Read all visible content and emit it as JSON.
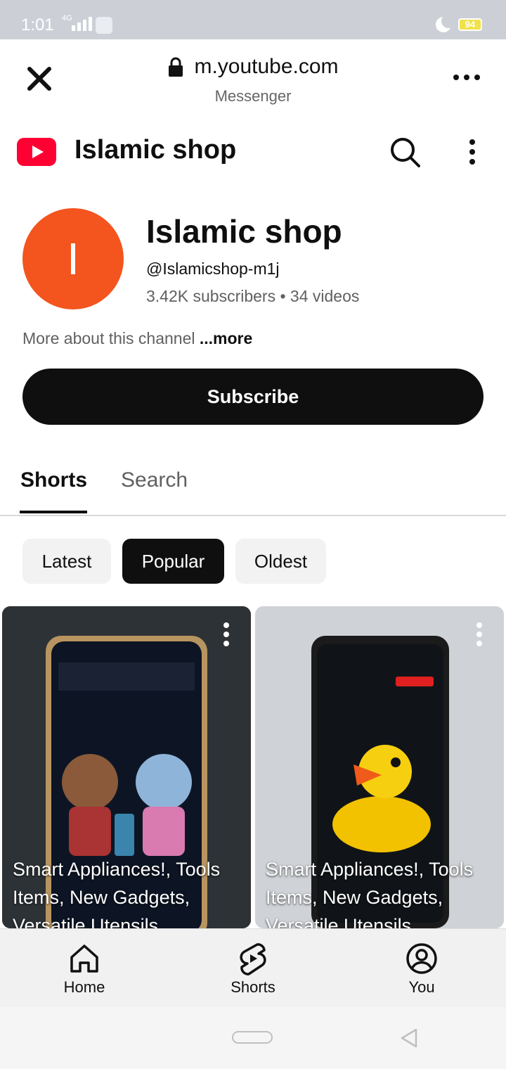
{
  "status_bar": {
    "time": "1:01",
    "network": "4G",
    "battery": "94"
  },
  "browser": {
    "url": "m.youtube.com",
    "subtitle": "Messenger"
  },
  "app_header": {
    "title": "Islamic shop"
  },
  "channel": {
    "avatar_letter": "I",
    "name": "Islamic shop",
    "handle": "@Islamicshop-m1j",
    "stats": "3.42K subscribers • 34 videos",
    "about": "More about this channel ",
    "about_more": "...more",
    "subscribe_label": "Subscribe"
  },
  "tabs": [
    {
      "label": "Shorts",
      "active": true
    },
    {
      "label": "Search",
      "active": false
    }
  ],
  "chips": [
    {
      "label": "Latest",
      "selected": false
    },
    {
      "label": "Popular",
      "selected": true
    },
    {
      "label": "Oldest",
      "selected": false
    }
  ],
  "shorts": [
    {
      "title": "Smart Appliances!, Tools Items, New Gadgets, Versatile Utensils"
    },
    {
      "title": "Smart Appliances!, Tools Items, New Gadgets, Versatile Utensils"
    }
  ],
  "bottom_nav": [
    {
      "label": "Home",
      "icon": "home-icon"
    },
    {
      "label": "Shorts",
      "icon": "shorts-icon"
    },
    {
      "label": "You",
      "icon": "account-icon"
    }
  ],
  "colors": {
    "youtube_red": "#ff0033",
    "avatar": "#f4541e",
    "primary_dark": "#0f0f0f"
  }
}
